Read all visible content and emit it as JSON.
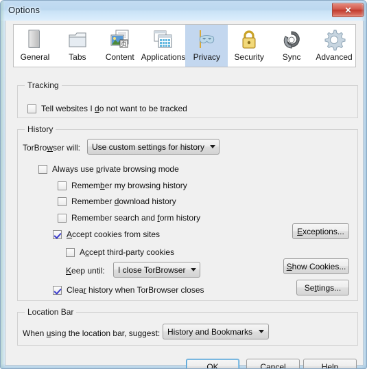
{
  "window": {
    "title": "Options",
    "close_label": "✕"
  },
  "tabs": [
    {
      "label": "General",
      "icon": "general-icon",
      "selected": false
    },
    {
      "label": "Tabs",
      "icon": "tabs-icon",
      "selected": false
    },
    {
      "label": "Content",
      "icon": "content-icon",
      "selected": false
    },
    {
      "label": "Applications",
      "icon": "applications-icon",
      "selected": false
    },
    {
      "label": "Privacy",
      "icon": "privacy-mask-icon",
      "selected": true
    },
    {
      "label": "Security",
      "icon": "security-lock-icon",
      "selected": false
    },
    {
      "label": "Sync",
      "icon": "sync-icon",
      "selected": false
    },
    {
      "label": "Advanced",
      "icon": "advanced-gear-icon",
      "selected": false
    }
  ],
  "tracking": {
    "group_title": "Tracking",
    "do_not_track": {
      "pre": "Tell websites I ",
      "accesskey": "d",
      "post": "o not want to be tracked",
      "checked": false
    }
  },
  "history": {
    "group_title": "History",
    "will_label": {
      "pre": "TorBro",
      "accesskey": "w",
      "post": "ser will:"
    },
    "will_value": "Use custom settings for history",
    "always_private": {
      "pre": "Always use ",
      "accesskey": "p",
      "post": "rivate browsing mode",
      "checked": false
    },
    "remember_browsing": {
      "pre": "Remem",
      "accesskey": "b",
      "post": "er my browsing history",
      "checked": false
    },
    "remember_download": {
      "pre": "Remember ",
      "accesskey": "d",
      "post": "ownload history",
      "checked": false
    },
    "remember_search_form": {
      "pre": "Remember search and ",
      "accesskey": "f",
      "post": "orm history",
      "checked": false
    },
    "accept_cookies": {
      "pre": "",
      "accesskey": "A",
      "post": "ccept cookies from sites",
      "checked": true
    },
    "accept_third_party": {
      "pre": "A",
      "accesskey": "c",
      "post": "cept third-party cookies",
      "checked": false
    },
    "keep_until_label": {
      "pre": "",
      "accesskey": "K",
      "post": "eep until:"
    },
    "keep_until_value": "I close TorBrowser",
    "clear_on_close": {
      "pre": "Clea",
      "accesskey": "r",
      "post": " history when TorBrowser closes",
      "checked": true
    },
    "exceptions_button": {
      "pre": "",
      "accesskey": "E",
      "post": "xceptions..."
    },
    "show_cookies_button": {
      "pre": "",
      "accesskey": "S",
      "post": "how Cookies..."
    },
    "settings_button": {
      "pre": "Se",
      "accesskey": "t",
      "post": "tings..."
    }
  },
  "location_bar": {
    "group_title": "Location Bar",
    "suggest_label": {
      "pre": "When ",
      "accesskey": "u",
      "post": "sing the location bar, suggest:"
    },
    "suggest_value": "History and Bookmarks"
  },
  "footer": {
    "ok": "OK",
    "cancel": "Cancel",
    "help": {
      "pre": "",
      "accesskey": "H",
      "post": "elp"
    }
  },
  "colors": {
    "selected_tab": "#c3d7ef",
    "dialog_bg": "#f0f0f0",
    "titlebar": "#c9e2f6",
    "close_button": "#c0392c",
    "check_mark": "#3b3bcb",
    "default_button_border": "#4a9bd1"
  }
}
